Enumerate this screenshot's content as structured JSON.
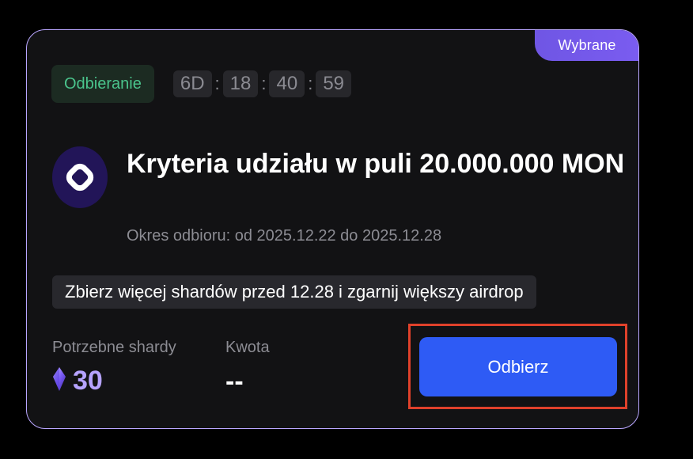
{
  "card": {
    "ribbon_label": "Wybrane",
    "status": "Odbieranie",
    "timer": {
      "days": "6D",
      "hours": "18",
      "minutes": "40",
      "seconds": "59",
      "separator": ":"
    },
    "title": "Kryteria udziału w puli 20.000.000 MON",
    "period": "Okres odbioru: od 2025.12.22 do 2025.12.28",
    "notice": "Zbierz więcej shardów przed 12.28 i zgarnij większy airdrop",
    "shards_label": "Potrzebne shardy",
    "shards_value": "30",
    "amount_label": "Kwota",
    "amount_value": "--",
    "claim_button": "Odbierz"
  },
  "colors": {
    "accent_purple": "#b9a6ff",
    "ribbon": "#6f56e4",
    "status_green": "#4ac48c",
    "button_blue": "#2e5bf5",
    "highlight_red": "#e0412b"
  },
  "icons": {
    "logo": "monad-logo-icon",
    "shard": "crystal-shard-icon"
  }
}
